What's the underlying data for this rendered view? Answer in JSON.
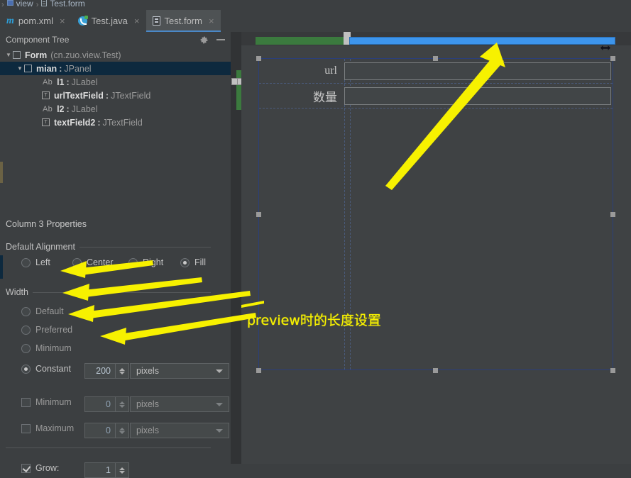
{
  "breadcrumb": {
    "package_icon": "package-icon",
    "package_label": "view",
    "separator": "›",
    "file_icon": "form-file-icon",
    "file_label": "Test.form"
  },
  "tabs": [
    {
      "label": "pom.xml",
      "icon": "maven-icon",
      "close": "×",
      "active": false
    },
    {
      "label": "Test.java",
      "icon": "java-class-icon",
      "close": "×",
      "active": false
    },
    {
      "label": "Test.form",
      "icon": "form-file-icon",
      "close": "×",
      "active": true
    }
  ],
  "component_tree": {
    "title": "Component Tree",
    "gear_icon": "gear-icon",
    "minimize_icon": "minimize-icon",
    "rows": [
      {
        "indent": 0,
        "twisty": "▼",
        "glyph": "checkbox-glyph",
        "name": "Form",
        "colon": "",
        "type": "",
        "pkg": "(cn.zuo.view.Test)",
        "selected": false
      },
      {
        "indent": 1,
        "twisty": "▼",
        "glyph": "checkbox-glyph",
        "name": "mian",
        "colon": ":",
        "type": "JPanel",
        "pkg": "",
        "selected": true
      },
      {
        "indent": 2,
        "twisty": "",
        "glyph": "label-glyph",
        "name": "l1",
        "colon": ":",
        "type": "JLabel",
        "pkg": "",
        "selected": false
      },
      {
        "indent": 2,
        "twisty": "",
        "glyph": "textfield-glyph",
        "name": "urlTextField",
        "colon": ":",
        "type": "JTextField",
        "pkg": "",
        "selected": false
      },
      {
        "indent": 2,
        "twisty": "",
        "glyph": "label-glyph",
        "name": "l2",
        "colon": ":",
        "type": "JLabel",
        "pkg": "",
        "selected": false
      },
      {
        "indent": 2,
        "twisty": "",
        "glyph": "textfield-glyph",
        "name": "textField2",
        "colon": ":",
        "type": "JTextField",
        "pkg": "",
        "selected": false
      }
    ],
    "label_prefix": "Ab"
  },
  "properties": {
    "title": "Column 3 Properties",
    "alignment": {
      "group_label": "Default Alignment",
      "options": [
        {
          "label": "Left",
          "underline": "L",
          "selected": false
        },
        {
          "label": "Center",
          "underline": "C",
          "selected": false
        },
        {
          "label": "Right",
          "underline": "R",
          "selected": false
        },
        {
          "label": "Fill",
          "underline": "F",
          "selected": true
        }
      ]
    },
    "width": {
      "group_label": "Width",
      "options": [
        {
          "label": "Default",
          "underline": "D",
          "selected": false,
          "enabled": false
        },
        {
          "label": "Preferred",
          "underline": "P",
          "selected": false,
          "enabled": false
        },
        {
          "label": "Minimum",
          "underline": "M",
          "selected": false,
          "enabled": false
        },
        {
          "label": "Constant",
          "underline": "t",
          "selected": true,
          "enabled": true
        }
      ],
      "constant_value": "200",
      "constant_units": "pixels"
    },
    "minimum": {
      "label": "Minimum",
      "checked": false,
      "value": "0",
      "units": "pixels"
    },
    "maximum": {
      "label": "Maximum",
      "checked": false,
      "value": "0",
      "units": "pixels"
    },
    "grow": {
      "label": "Grow:",
      "checked": true,
      "value": "1"
    }
  },
  "canvas": {
    "ruler": {
      "green_segment": "column-1-width-indicator",
      "blue_segment": "column-3-width-indicator",
      "drag_handle": "column-resize-handle",
      "resize_cursor_icon": "horizontal-resize-cursor-icon"
    },
    "form_rows": [
      {
        "label": "url",
        "field": "urlTextField",
        "value": ""
      },
      {
        "label": "数量",
        "field": "textField2",
        "value": ""
      }
    ],
    "annotation": "preview时的长度设置"
  },
  "colors": {
    "background": "#3c3f41",
    "canvas_background": "#3f4244",
    "tab_active": "#4e5254",
    "tab_underline": "#4a88c7",
    "tree_selection": "#0d293e",
    "ruler_green": "#3b7a3e",
    "ruler_blue": "#3d95ec",
    "annotation_yellow": "#f7f100",
    "form_border": "#2b3f7a"
  }
}
